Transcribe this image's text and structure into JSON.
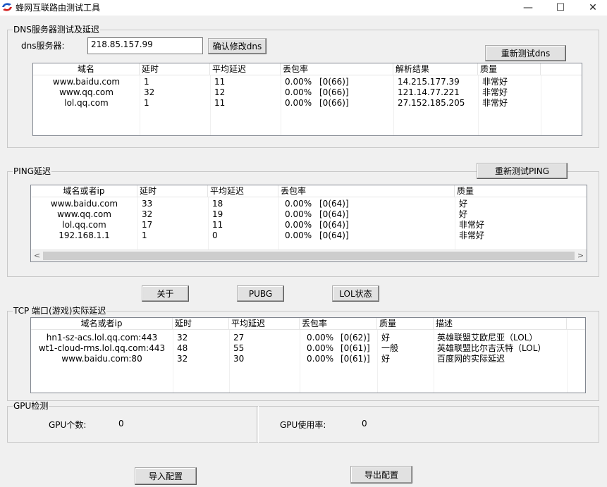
{
  "window": {
    "title": "蜂网互联路由测试工具",
    "minimize": "—",
    "maximize": "☐",
    "close": "✕"
  },
  "dns": {
    "group_label": "DNS服务器测试及延迟",
    "server_label": "dns服务器:",
    "server_value": "218.85.157.99",
    "confirm_button": "确认修改dns",
    "retest_button": "重新测试dns",
    "columns": [
      "域名",
      "延时",
      "平均延迟",
      "丢包率",
      "解析结果",
      "质量"
    ],
    "rows": [
      [
        "www.baidu.com",
        "1",
        "11",
        "0.00%",
        "[0(66)]",
        "14.215.177.39",
        "非常好"
      ],
      [
        "www.qq.com",
        "32",
        "12",
        "0.00%",
        "[0(66)]",
        "121.14.77.221",
        "非常好"
      ],
      [
        "lol.qq.com",
        "1",
        "11",
        "0.00%",
        "[0(66)]",
        "27.152.185.205",
        "非常好"
      ]
    ]
  },
  "ping": {
    "group_label": "PING延迟",
    "retest_button": "重新测试PING",
    "columns": [
      "域名或者ip",
      "延时",
      "平均延迟",
      "丢包率",
      "质量"
    ],
    "rows": [
      [
        "www.baidu.com",
        "33",
        "18",
        "0.00%",
        "[0(64)]",
        "好"
      ],
      [
        "www.qq.com",
        "32",
        "19",
        "0.00%",
        "[0(64)]",
        "好"
      ],
      [
        "lol.qq.com",
        "17",
        "11",
        "0.00%",
        "[0(64)]",
        "非常好"
      ],
      [
        "192.168.1.1",
        "1",
        "0",
        "0.00%",
        "[0(64)]",
        "非常好"
      ]
    ],
    "scroll_left": "<",
    "scroll_right": ">"
  },
  "buttons": {
    "about": "关于",
    "pubg": "PUBG",
    "lol_status": "LOL状态",
    "import_config": "导入配置",
    "export_config": "导出配置"
  },
  "tcp": {
    "group_label": "TCP 端口(游戏)实际延迟",
    "columns": [
      "域名或者ip",
      "延时",
      "平均延迟",
      "丢包率",
      "质量",
      "描述"
    ],
    "rows": [
      [
        "hn1-sz-acs.lol.qq.com:443",
        "32",
        "27",
        "0.00%",
        "[0(62)]",
        "好",
        "英雄联盟艾欧尼亚（LOL）"
      ],
      [
        "wt1-cloud-rms.lol.qq.com:443",
        "48",
        "55",
        "0.00%",
        "[0(61)]",
        "一般",
        "英雄联盟比尔吉沃特（LOL）"
      ],
      [
        "www.baidu.com:80",
        "32",
        "30",
        "0.00%",
        "[0(61)]",
        "好",
        "百度网的实际延迟"
      ]
    ]
  },
  "gpu": {
    "group_label": "GPU检测",
    "count_label": "GPU个数:",
    "count_value": "0",
    "usage_label": "GPU使用率:",
    "usage_value": "0"
  },
  "colors": {
    "accent_logo_blue": "#1a56c4",
    "accent_logo_red": "#d42020"
  }
}
